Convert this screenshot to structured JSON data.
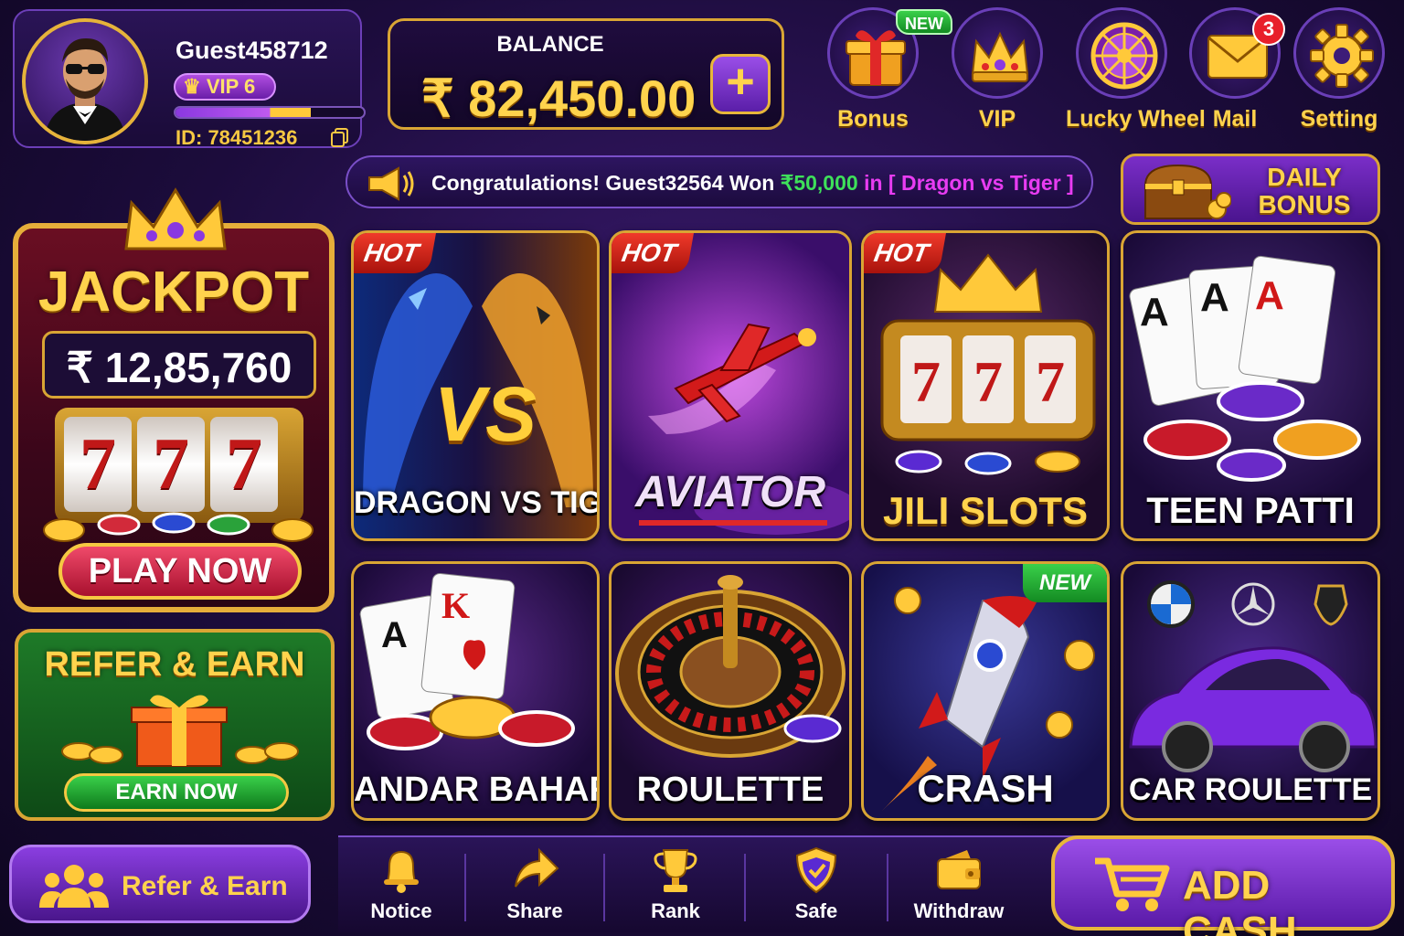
{
  "profile": {
    "username": "Guest458712",
    "vip_label": "VIP 6",
    "vip_progress": 0.72,
    "user_id": "ID: 78451236"
  },
  "balance": {
    "label": "BALANCE",
    "value": "₹ 82,450.00",
    "add_symbol": "+"
  },
  "top_icons": [
    {
      "label": "Bonus",
      "icon": "gift-icon"
    },
    {
      "label": "VIP",
      "icon": "crown-icon"
    },
    {
      "label": "Lucky Wheel",
      "icon": "wheel-icon"
    },
    {
      "label": "Mail",
      "icon": "mail-icon"
    },
    {
      "label": "Setting",
      "icon": "gear-icon"
    }
  ],
  "badges": {
    "bonus_new": "NEW",
    "mail_count": "3"
  },
  "ticker": {
    "prefix": "Congratulations! Guest32564 Won ",
    "amount": "₹50,000",
    "middle": " in ",
    "game": "[ Dragon vs Tiger ]"
  },
  "daily_bonus": {
    "line1": "DAILY",
    "line2": "BONUS"
  },
  "jackpot": {
    "title": "JACKPOT",
    "amount": "₹ 12,85,760",
    "reels": [
      "7",
      "7",
      "7"
    ],
    "play_label": "PLAY NOW"
  },
  "refer_card": {
    "title": "REFER & EARN",
    "button": "EARN NOW"
  },
  "games": [
    {
      "name": "DRAGON VS TIGER",
      "tag": "HOT",
      "vs_text": "VS"
    },
    {
      "name": "AVIATOR",
      "tag": "HOT"
    },
    {
      "name": "JILI SLOTS",
      "tag": "HOT",
      "reels": [
        "7",
        "7",
        "7"
      ]
    },
    {
      "name": "TEEN PATTI",
      "tag": "",
      "cards": [
        "A",
        "A",
        "A"
      ]
    },
    {
      "name": "ANDAR BAHAR",
      "tag": "",
      "cards": [
        "A",
        "K"
      ]
    },
    {
      "name": "ROULETTE",
      "tag": ""
    },
    {
      "name": "CRASH",
      "tag": "NEW"
    },
    {
      "name": "CAR ROULETTE",
      "tag": ""
    }
  ],
  "bottom_nav": {
    "refer_label": "Refer & Earn",
    "items": [
      {
        "label": "Notice",
        "icon": "bell-icon"
      },
      {
        "label": "Share",
        "icon": "share-arrow-icon"
      },
      {
        "label": "Rank",
        "icon": "trophy-icon"
      },
      {
        "label": "Safe",
        "icon": "shield-icon"
      },
      {
        "label": "Withdraw",
        "icon": "wallet-icon"
      }
    ],
    "add_cash_label": "ADD CASH"
  },
  "colors": {
    "gold": "#ffd34d",
    "purple": "#5a1ea8",
    "green": "#3ad04a",
    "red": "#c01818",
    "win_green": "#3ee05a",
    "game_magenta": "#e83cf2"
  }
}
